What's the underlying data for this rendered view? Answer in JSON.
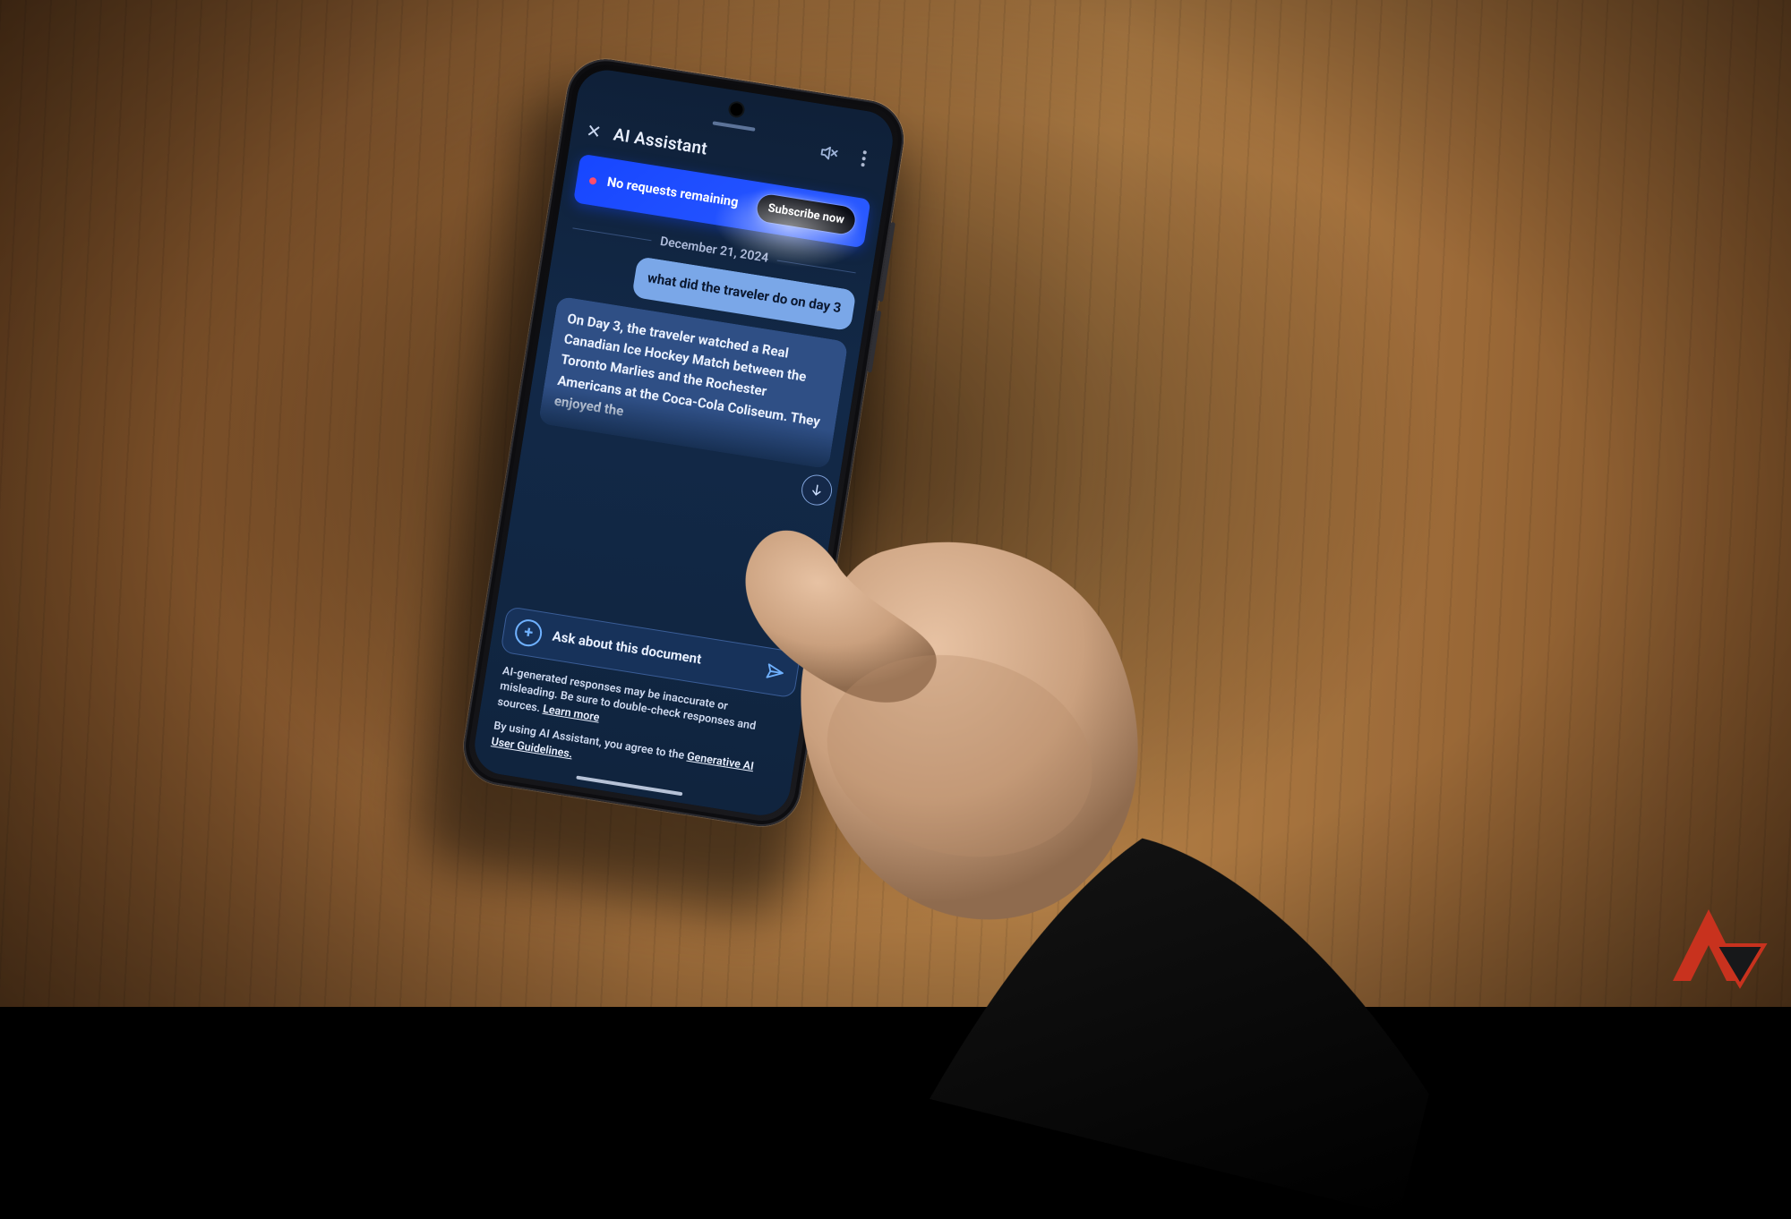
{
  "header": {
    "title": "AI Assistant"
  },
  "banner": {
    "message": "No requests remaining",
    "cta": "Subscribe now"
  },
  "date_divider": "December 21, 2024",
  "chat": {
    "user_message": "what did the traveler do on day 3",
    "assistant_message": "On Day 3, the traveler watched a Real Canadian Ice Hockey Match between the Toronto Marlies and the Rochester Americans at the Coca-Cola Coliseum. They enjoyed the"
  },
  "composer": {
    "placeholder": "Ask about this document"
  },
  "disclaimer": {
    "text": "AI-generated responses may be inaccurate or misleading. Be sure to double-check responses and sources.",
    "link": "Learn more"
  },
  "agreement": {
    "text": "By using AI Assistant, you agree to the",
    "link": "Generative AI User Guidelines."
  },
  "icons": {
    "close": "close-icon",
    "mute": "speaker-muted-icon",
    "more": "more-vertical-icon",
    "scroll_down": "arrow-down-icon",
    "attach": "plus-circle-icon",
    "send": "send-icon"
  }
}
